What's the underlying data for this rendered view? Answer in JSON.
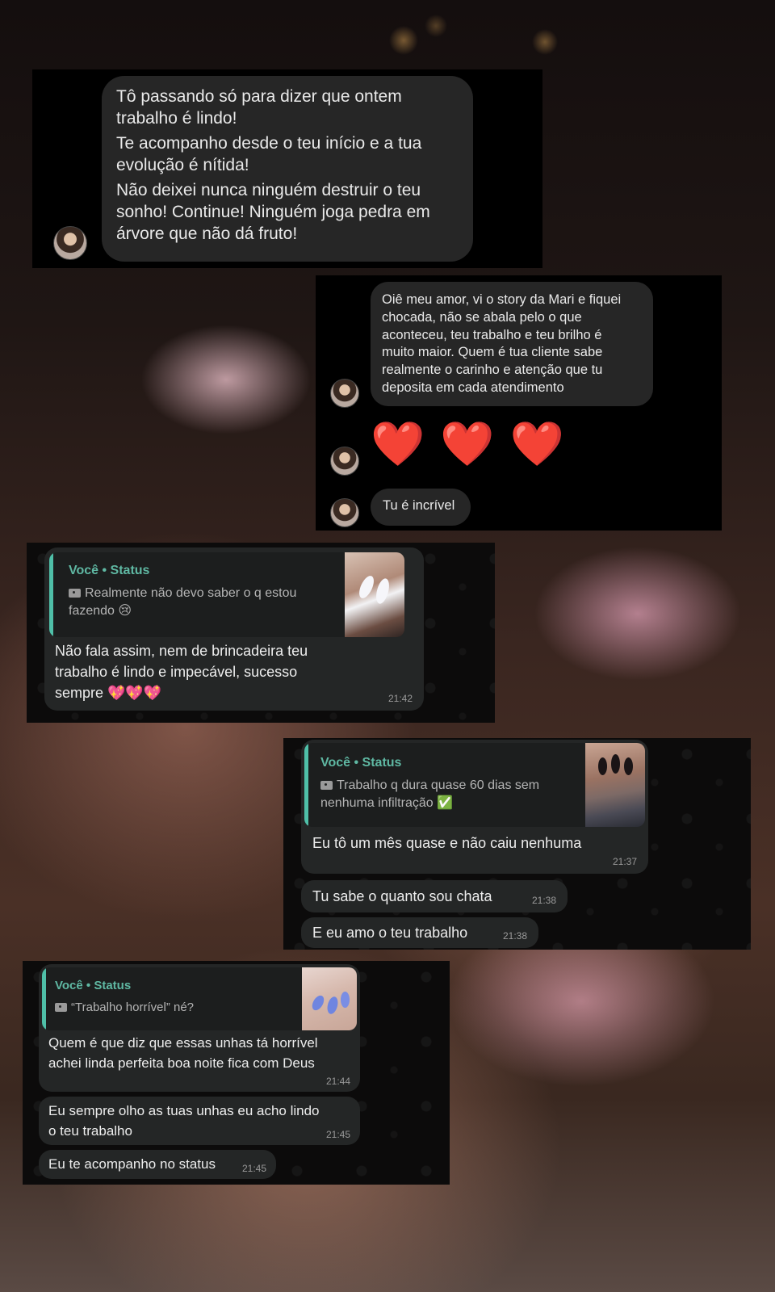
{
  "panel1": {
    "lines": [
      "Tô passando só para dizer que ontem",
      "trabalho é lindo!",
      "Te acompanho desde o teu início e a tua",
      "evolução é nítida!",
      "Não deixei nunca ninguém destruir o teu",
      "sonho! Continue!  Ninguém joga pedra em",
      "árvore que não dá fruto!"
    ]
  },
  "panel2": {
    "message_lines": [
      "Oiê meu amor, vi o story da Mari e fiquei",
      "chocada, não se abala pelo o que",
      "aconteceu, teu trabalho e teu brilho é",
      "muito maior. Quem é tua cliente sabe",
      "realmente o carinho e atenção que tu",
      "deposita em cada atendimento"
    ],
    "hearts": "❤️ ❤️ ❤️",
    "short_message": "Tu é incrível"
  },
  "panel3": {
    "quote_author": "Você • Status",
    "quote_lines": [
      "Realmente não devo saber o q estou",
      "fazendo 😢"
    ],
    "message_lines": [
      "Não fala assim, nem de brincadeira teu",
      "trabalho é lindo e impecável, sucesso",
      "sempre 💖💖💖"
    ],
    "time": "21:42"
  },
  "panel4": {
    "quote_author": "Você • Status",
    "quote_lines": [
      "Trabalho q dura quase 60 dias sem",
      "nenhuma infiltração ✅"
    ],
    "messages": [
      {
        "text": "Eu tô um mês quase e não caiu nenhuma",
        "time": "21:37"
      },
      {
        "text": "Tu sabe o quanto sou chata",
        "time": "21:38"
      },
      {
        "text": "E eu amo o teu trabalho",
        "time": "21:38"
      }
    ]
  },
  "panel5": {
    "quote_author": "Você • Status",
    "quote_line": "“Trabalho horrível” né?",
    "messages": [
      {
        "lines": [
          "Quem é que diz que essas unhas tá horrível",
          "achei linda perfeita boa noite fica com Deus"
        ],
        "time": "21:44"
      },
      {
        "lines": [
          "Eu sempre olho as tuas unhas eu acho lindo",
          "o teu trabalho"
        ],
        "time": "21:45"
      },
      {
        "lines": [
          "Eu te acompanho no status"
        ],
        "time": "21:45"
      }
    ]
  },
  "colors": {
    "accent_status": "#5fb8a3",
    "bubble": "#242626",
    "panel_black": "#000000"
  }
}
